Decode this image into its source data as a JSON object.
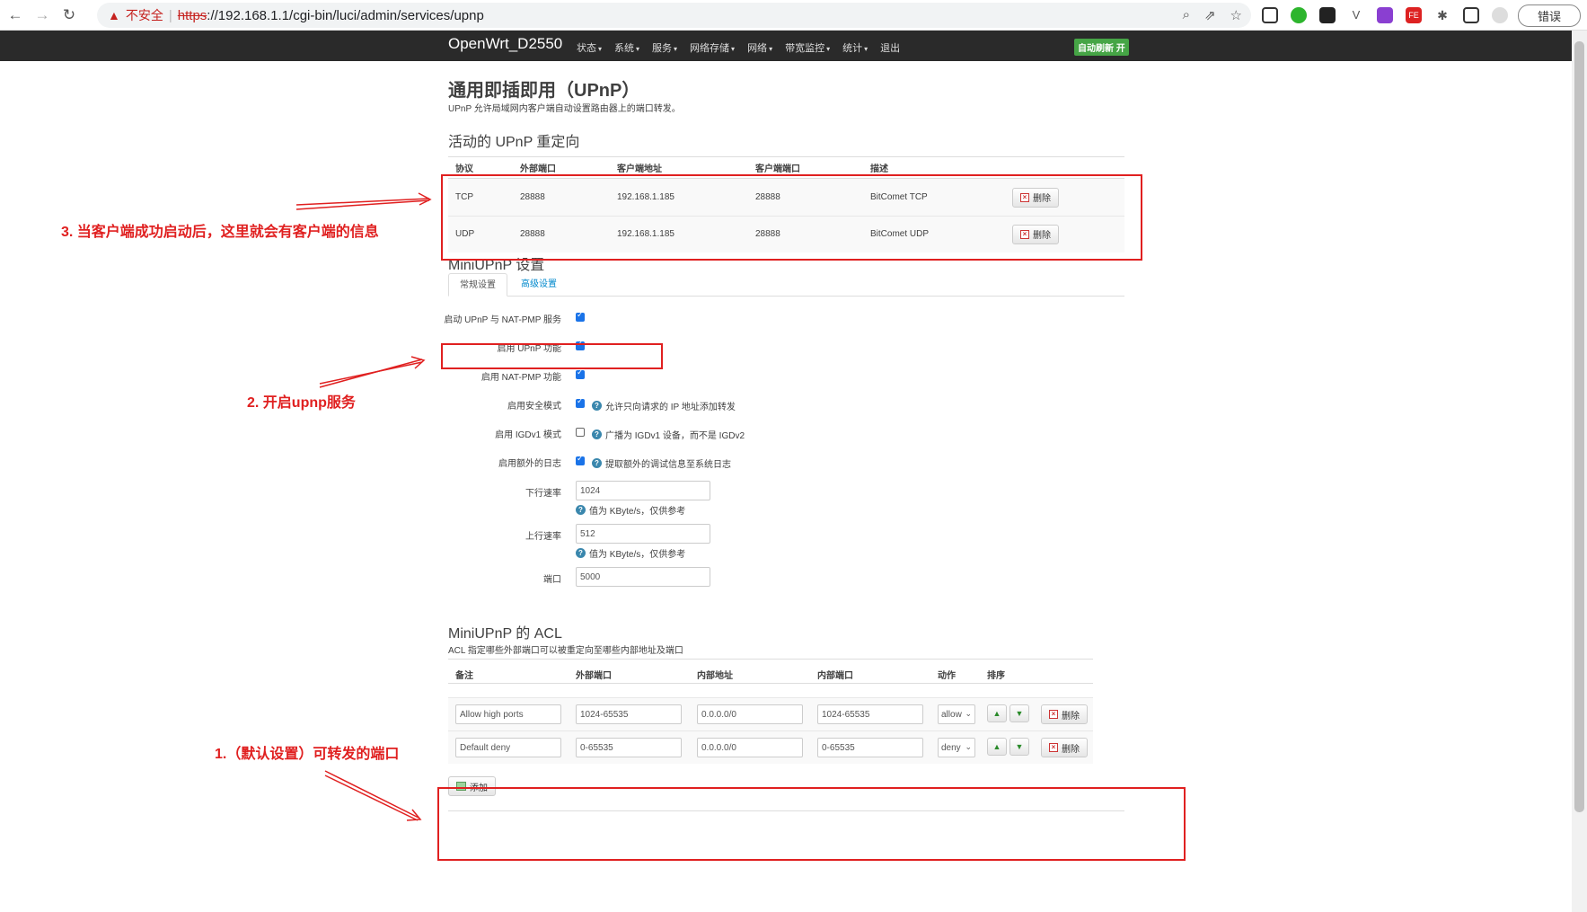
{
  "browser": {
    "insecure_label": "不安全",
    "url_scheme": "https",
    "url_rest": "://192.168.1.1/cgi-bin/luci/admin/services/upnp",
    "error_button": "错误"
  },
  "navbar": {
    "brand": "OpenWrt_D2550",
    "menu": [
      "状态",
      "系统",
      "服务",
      "网络存储",
      "网络",
      "带宽监控",
      "统计",
      "退出"
    ],
    "auto_refresh": "自动刷新 开"
  },
  "page": {
    "title": "通用即插即用（UPnP）",
    "description": "UPnP 允许局域网内客户端自动设置路由器上的端口转发。"
  },
  "redirects": {
    "heading": "活动的 UPnP 重定向",
    "columns": [
      "协议",
      "外部端口",
      "客户端地址",
      "客户端端口",
      "描述"
    ],
    "rows": [
      {
        "protocol": "TCP",
        "ext_port": "28888",
        "client_addr": "192.168.1.185",
        "client_port": "28888",
        "desc": "BitComet TCP",
        "action": "删除"
      },
      {
        "protocol": "UDP",
        "ext_port": "28888",
        "client_addr": "192.168.1.185",
        "client_port": "28888",
        "desc": "BitComet UDP",
        "action": "删除"
      }
    ]
  },
  "settings": {
    "heading": "MiniUPnP 设置",
    "tabs": [
      "常规设置",
      "高级设置"
    ],
    "fields": {
      "enable_service": {
        "label": "启动 UPnP 与 NAT-PMP 服务",
        "checked": true
      },
      "enable_upnp": {
        "label": "启用 UPnP 功能",
        "checked": true
      },
      "enable_natpmp": {
        "label": "启用 NAT-PMP 功能",
        "checked": true
      },
      "secure_mode": {
        "label": "启用安全模式",
        "checked": true,
        "hint": "允许只向请求的 IP 地址添加转发"
      },
      "igdv1": {
        "label": "启用 IGDv1 模式",
        "checked": false,
        "hint": "广播为 IGDv1 设备，而不是 IGDv2"
      },
      "extra_log": {
        "label": "启用额外的日志",
        "checked": true,
        "hint": "提取额外的调试信息至系统日志"
      },
      "download": {
        "label": "下行速率",
        "value": "1024",
        "hint": "值为 KByte/s，仅供参考"
      },
      "upload": {
        "label": "上行速率",
        "value": "512",
        "hint": "值为 KByte/s，仅供参考"
      },
      "port": {
        "label": "端口",
        "value": "5000"
      }
    }
  },
  "acl": {
    "heading": "MiniUPnP 的 ACL",
    "description": "ACL 指定哪些外部端口可以被重定向至哪些内部地址及端口",
    "columns": [
      "备注",
      "外部端口",
      "内部地址",
      "内部端口",
      "动作",
      "排序"
    ],
    "rows": [
      {
        "comment": "Allow high ports",
        "ext_ports": "1024-65535",
        "int_addr": "0.0.0.0/0",
        "int_ports": "1024-65535",
        "action": "allow",
        "delete": "删除"
      },
      {
        "comment": "Default deny",
        "ext_ports": "0-65535",
        "int_addr": "0.0.0.0/0",
        "int_ports": "0-65535",
        "action": "deny",
        "delete": "删除"
      }
    ],
    "add_button": "添加"
  },
  "annotations": {
    "note3": "3. 当客户端成功启动后，这里就会有客户端的信息",
    "note2": "2. 开启upnp服务",
    "note1": "1.（默认设置）可转发的端口"
  },
  "colors": {
    "annotation": "#e02020",
    "navbar": "#2a2a2a",
    "auto_refresh": "#46a546"
  }
}
